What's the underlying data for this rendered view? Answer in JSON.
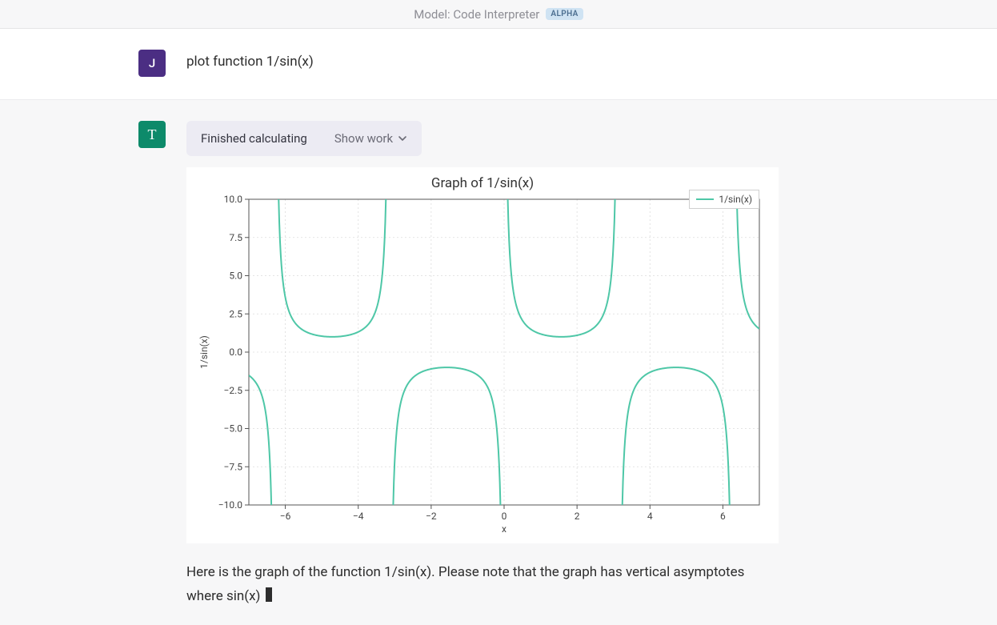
{
  "header": {
    "model_label": "Model: Code Interpreter",
    "badge": "ALPHA"
  },
  "user": {
    "avatar_initial": "J",
    "prompt": "plot function 1/sin(x)"
  },
  "assistant": {
    "avatar_initial": "T",
    "status_text": "Finished calculating",
    "show_work_label": "Show work",
    "response_text": "Here is the graph of the function 1/sin(x). Please note that the graph has vertical asymptotes where sin(x) "
  },
  "chart_data": {
    "type": "line",
    "title": "Graph of 1/sin(x)",
    "xlabel": "x",
    "ylabel": "1/sin(x)",
    "xlim": [
      -7,
      7
    ],
    "ylim": [
      -10,
      10
    ],
    "xticks": [
      -6,
      -4,
      -2,
      0,
      2,
      4,
      6
    ],
    "yticks": [
      -10.0,
      -7.5,
      -5.0,
      -2.5,
      0.0,
      2.5,
      5.0,
      7.5,
      10.0
    ],
    "legend": [
      "1/sin(x)"
    ],
    "asymptotes_x": [
      -6.283,
      -3.142,
      0,
      3.142,
      6.283
    ],
    "series": [
      {
        "name": "1/sin(x)",
        "formula": "1/sin(x)",
        "color": "#4ec7a7"
      }
    ],
    "sample_points": {
      "x": [
        -6.0,
        -5.5,
        -5.0,
        -4.71,
        -4.5,
        -4.0,
        -3.5,
        -2.8,
        -2.5,
        -2.0,
        -1.57,
        -1.0,
        -0.5,
        -0.3,
        0.3,
        0.5,
        1.0,
        1.57,
        2.0,
        2.5,
        2.8,
        3.5,
        4.0,
        4.5,
        4.71,
        5.0,
        5.5,
        6.0
      ],
      "y": [
        3.58,
        1.42,
        1.04,
        1.0,
        1.02,
        1.32,
        2.85,
        -2.98,
        -1.67,
        -1.1,
        -1.0,
        -1.19,
        -2.09,
        -3.38,
        3.38,
        2.09,
        1.19,
        1.0,
        1.1,
        1.67,
        2.98,
        -2.85,
        -1.32,
        -1.02,
        -1.0,
        -1.04,
        -1.42,
        -3.58
      ]
    }
  }
}
